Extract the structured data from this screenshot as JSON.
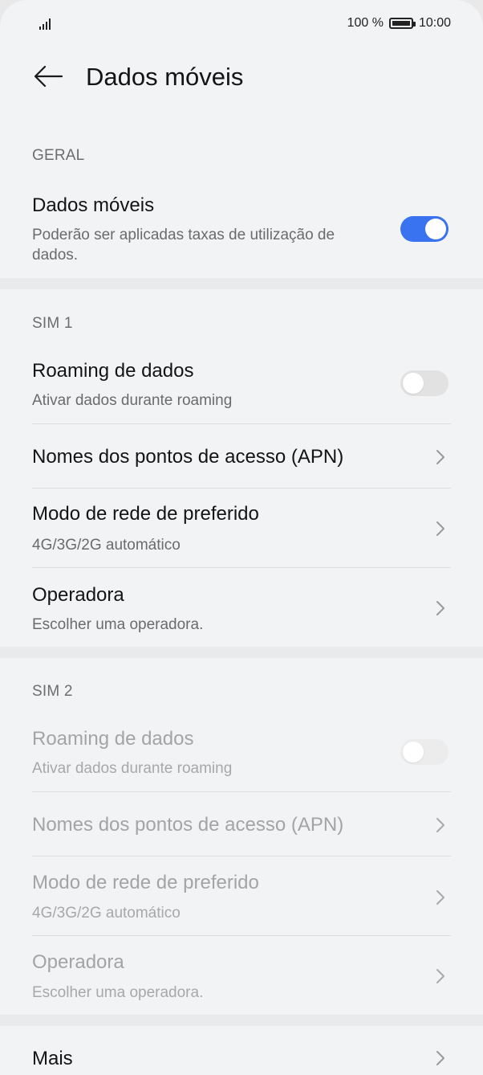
{
  "status": {
    "battery_text": "100 %",
    "time": "10:00"
  },
  "header": {
    "title": "Dados móveis"
  },
  "general": {
    "section_label": "GERAL",
    "mobile_data": {
      "title": "Dados móveis",
      "subtitle": "Poderão ser aplicadas taxas de utilização de dados.",
      "enabled": true
    }
  },
  "sim1": {
    "section_label": "SIM 1",
    "roaming": {
      "title": "Roaming de dados",
      "subtitle": "Ativar dados durante roaming",
      "enabled": false
    },
    "apn": {
      "title": "Nomes dos pontos de acesso (APN)"
    },
    "network_mode": {
      "title": "Modo de rede de preferido",
      "subtitle": "4G/3G/2G automático"
    },
    "operator": {
      "title": "Operadora",
      "subtitle": "Escolher uma operadora."
    }
  },
  "sim2": {
    "section_label": "SIM 2",
    "roaming": {
      "title": "Roaming de dados",
      "subtitle": "Ativar dados durante roaming",
      "enabled": false
    },
    "apn": {
      "title": "Nomes dos pontos de acesso (APN)"
    },
    "network_mode": {
      "title": "Modo de rede de preferido",
      "subtitle": "4G/3G/2G automático"
    },
    "operator": {
      "title": "Operadora",
      "subtitle": "Escolher uma operadora."
    }
  },
  "more": {
    "title": "Mais"
  },
  "colors": {
    "accent": "#3a73f0",
    "background": "#f1f3f5",
    "text_primary": "#141414",
    "text_secondary": "#6b6b6b",
    "text_disabled": "#a4a4a4"
  },
  "icons": {
    "back": "arrow-left-icon",
    "chevron": "chevron-right-icon",
    "signal": "signal-icon",
    "battery": "battery-icon"
  }
}
